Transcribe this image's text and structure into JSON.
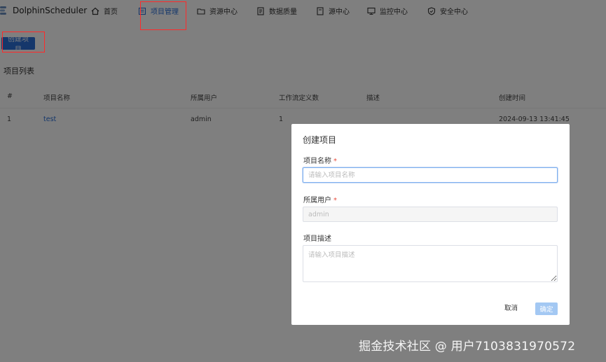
{
  "app": {
    "title": "DolphinScheduler"
  },
  "nav": {
    "items": [
      {
        "label": "首页",
        "icon": "home-icon"
      },
      {
        "label": "项目管理",
        "icon": "project-icon",
        "active": true
      },
      {
        "label": "资源中心",
        "icon": "folder-icon"
      },
      {
        "label": "数据质量",
        "icon": "data-quality-icon"
      },
      {
        "label": "源中心",
        "icon": "datasource-icon"
      },
      {
        "label": "监控中心",
        "icon": "monitor-icon"
      },
      {
        "label": "安全中心",
        "icon": "shield-icon"
      }
    ]
  },
  "toolbar": {
    "create_label": "创建项目"
  },
  "section": {
    "title": "项目列表"
  },
  "table": {
    "headers": [
      "#",
      "项目名称",
      "所属用户",
      "工作流定义数",
      "描述",
      "创建时间"
    ],
    "rows": [
      [
        "1",
        "test",
        "admin",
        "1",
        "",
        "2024-09-13 13:41:45"
      ]
    ]
  },
  "modal": {
    "title": "创建项目",
    "name_label": "项目名称",
    "name_placeholder": "请输入项目名称",
    "user_label": "所属用户",
    "user_value": "admin",
    "desc_label": "项目描述",
    "desc_placeholder": "请输入项目描述",
    "required_mark": "*",
    "cancel_label": "取消",
    "confirm_label": "确定"
  },
  "watermark": {
    "text": "掘金技术社区 @ 用户7103831970572"
  },
  "colors": {
    "accent": "#2a6fd6",
    "highlight": "#ff2a2a",
    "confirm_disabled": "#a3c8f3"
  }
}
